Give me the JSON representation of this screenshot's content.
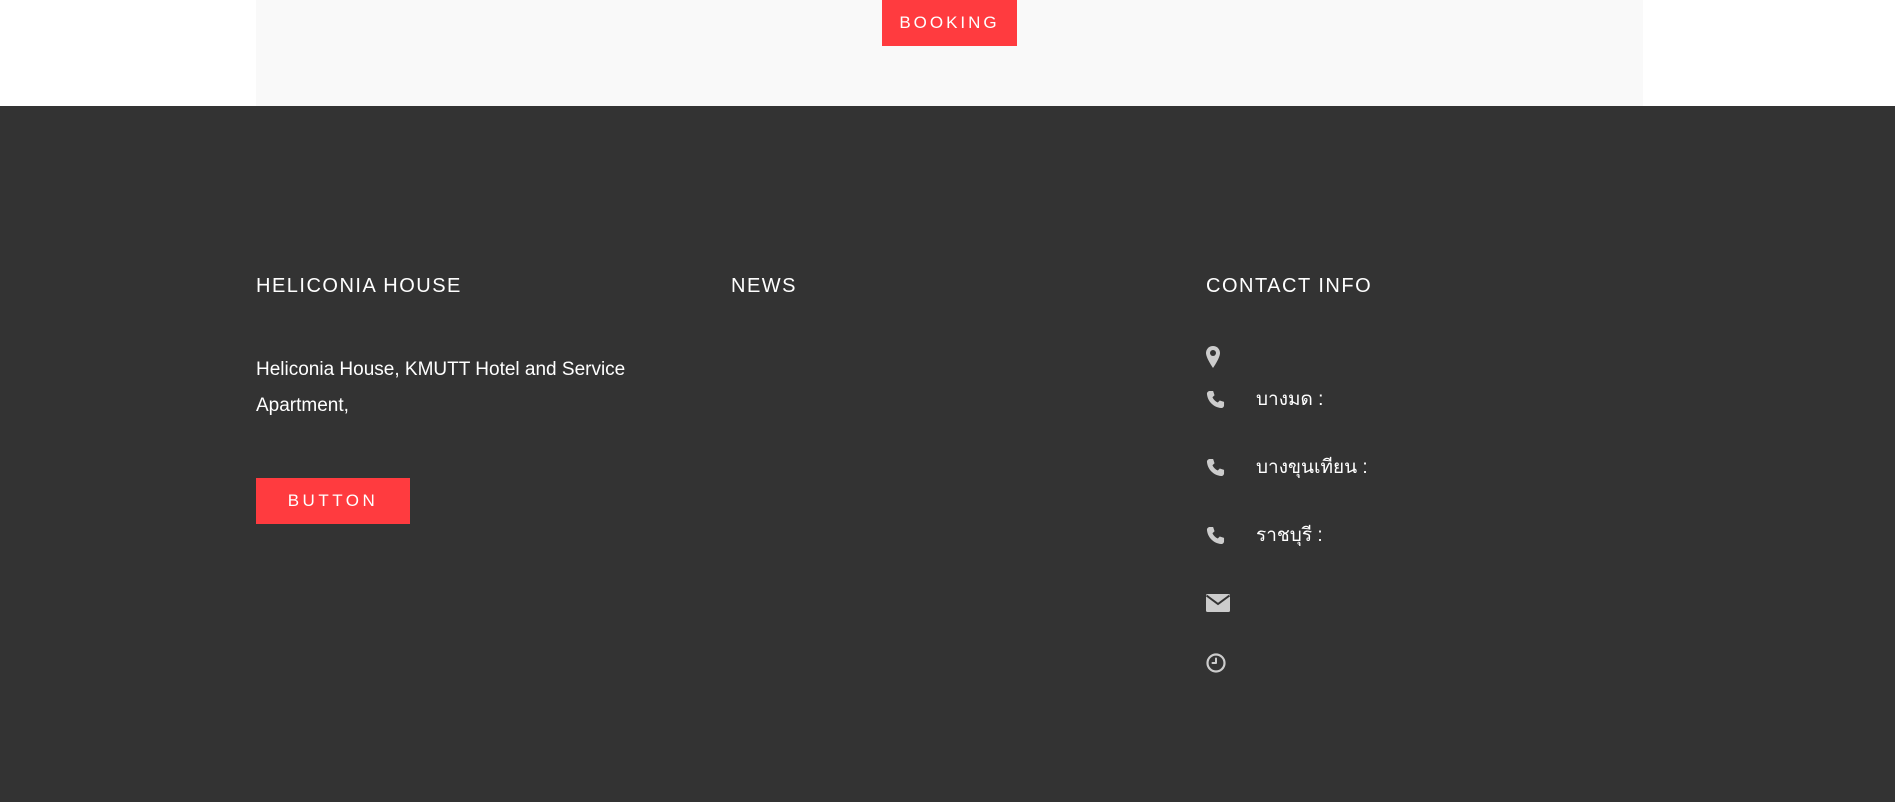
{
  "top": {
    "booking_label": "BOOKING"
  },
  "footer": {
    "about": {
      "title": "HELICONIA HOUSE",
      "text": "Heliconia House, KMUTT Hotel and Service Apartment,",
      "button_label": "BUTTON"
    },
    "news": {
      "title": "NEWS"
    },
    "contact": {
      "title": "CONTACT INFO",
      "items": [
        {
          "icon": "map-marker-icon",
          "label": ""
        },
        {
          "icon": "phone-icon",
          "label": "บางมด :"
        },
        {
          "icon": "phone-icon",
          "label": "บางขุนเทียน :"
        },
        {
          "icon": "phone-icon",
          "label": "ราชบุรี :"
        },
        {
          "icon": "envelope-icon",
          "label": ""
        },
        {
          "icon": "clock-icon",
          "label": ""
        }
      ]
    }
  },
  "colors": {
    "accent": "#ff3b3f",
    "footer_bg": "#333333",
    "top_panel_bg": "#f9f9f9",
    "icon": "#cccccc",
    "text": "#ffffff"
  }
}
